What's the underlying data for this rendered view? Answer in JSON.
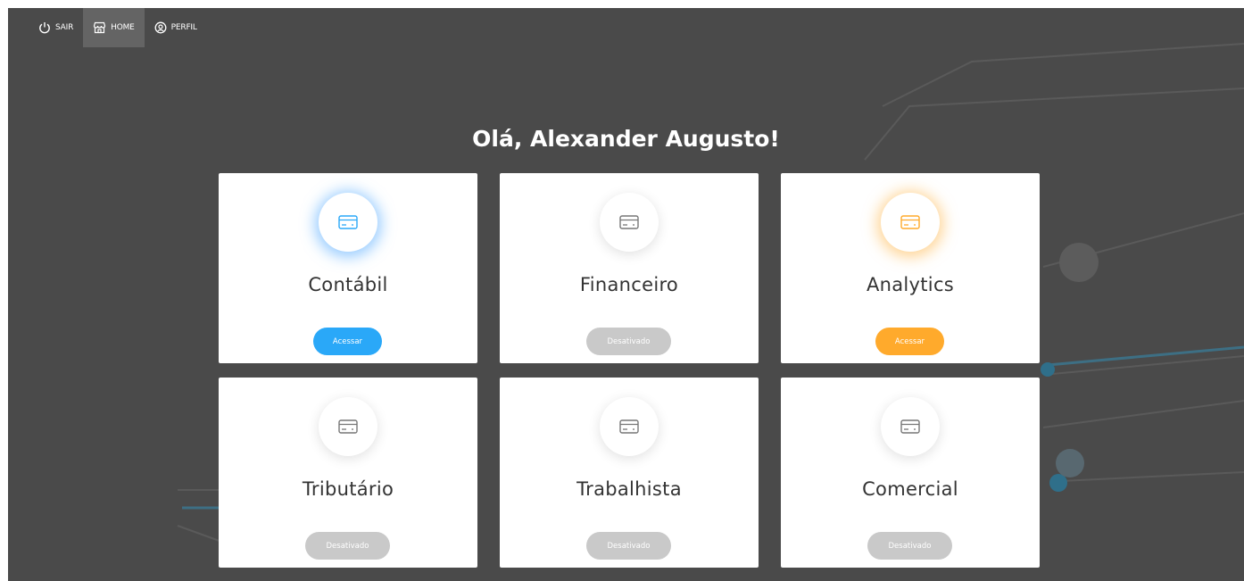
{
  "nav": [
    {
      "label": "SAIR",
      "icon": "power-icon",
      "active": false
    },
    {
      "label": "HOME",
      "icon": "store-icon",
      "active": true
    },
    {
      "label": "PERFIL",
      "icon": "user-circle-icon",
      "active": false
    }
  ],
  "greeting": "Olá, Alexander Augusto!",
  "colors": {
    "background": "#4a4a4a",
    "blue": "#2aa8f8",
    "orange": "#ffaa2c",
    "disabled": "#c9c9c9",
    "icon_gray": "#777777"
  },
  "modules": [
    {
      "title": "Contábil",
      "button": "Acessar",
      "status": "active",
      "color": "#2aa8f8",
      "icon": "credit-card-icon"
    },
    {
      "title": "Financeiro",
      "button": "Desativado",
      "status": "disabled",
      "color": "#c9c9c9",
      "icon": "credit-card-icon"
    },
    {
      "title": "Analytics",
      "button": "Acessar",
      "status": "active",
      "color": "#ffaa2c",
      "icon": "credit-card-icon"
    },
    {
      "title": "Tributário",
      "button": "Desativado",
      "status": "disabled",
      "color": "#c9c9c9",
      "icon": "credit-card-icon"
    },
    {
      "title": "Trabalhista",
      "button": "Desativado",
      "status": "disabled",
      "color": "#c9c9c9",
      "icon": "credit-card-icon"
    },
    {
      "title": "Comercial",
      "button": "Desativado",
      "status": "disabled",
      "color": "#c9c9c9",
      "icon": "credit-card-icon"
    }
  ]
}
